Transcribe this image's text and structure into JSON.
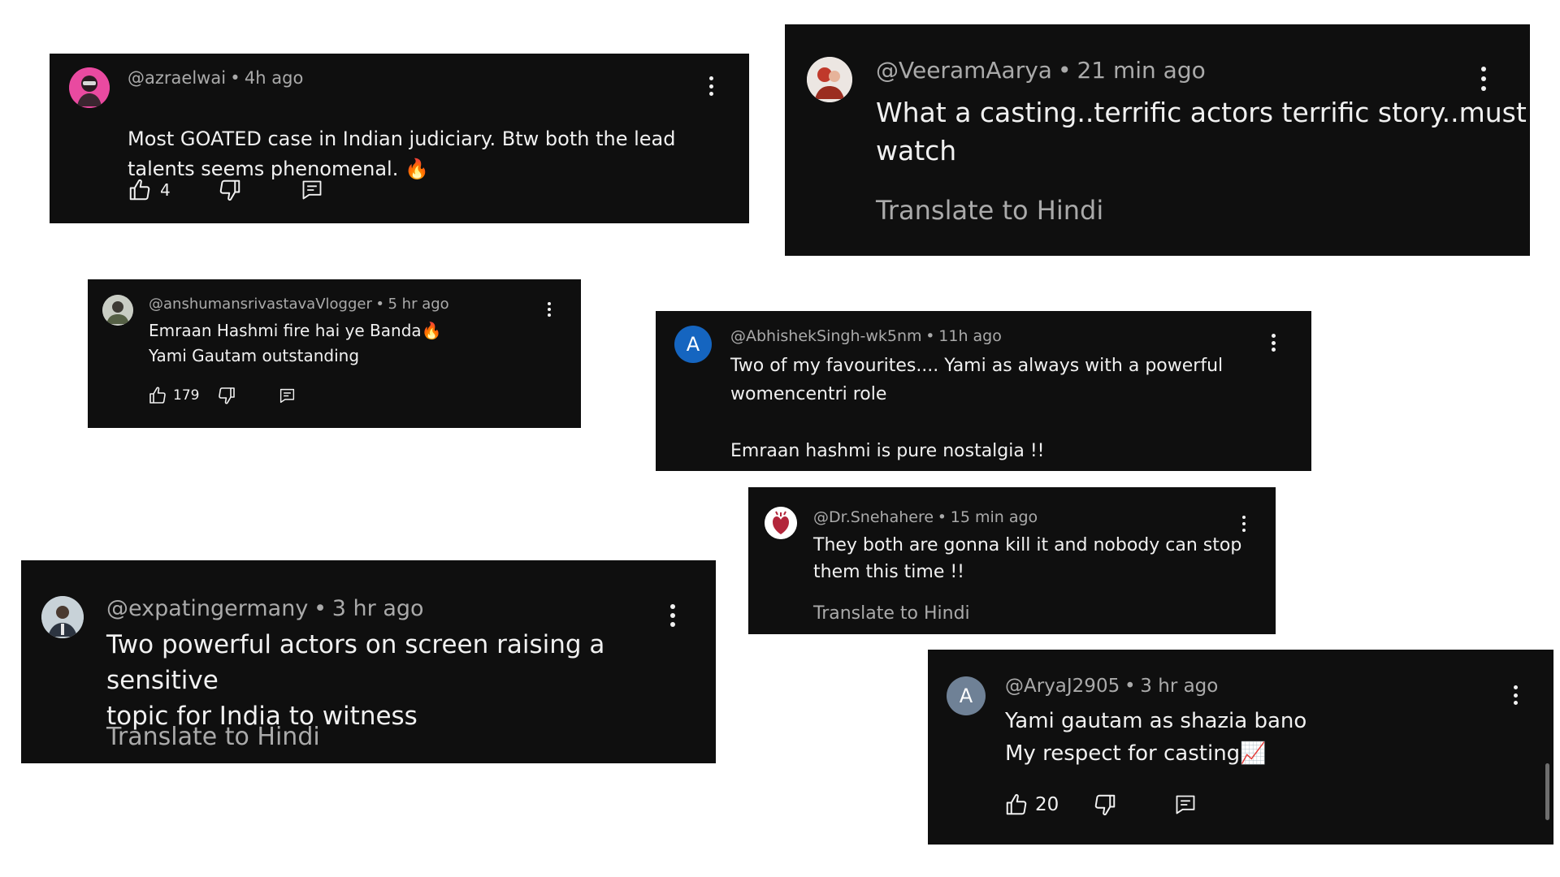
{
  "theme": {
    "card_background": "#0f0f0f",
    "text_primary": "#f1f1f1",
    "text_secondary": "#aaaaaa",
    "avatar_blue": "#1565c0",
    "avatar_gray": "#6f8196"
  },
  "icons": {
    "like": "thumbs-up-icon",
    "dislike": "thumbs-down-icon",
    "reply": "comment-icon",
    "menu": "more-vert-icon",
    "fire": "fire-emoji",
    "chart": "chart-increasing-emoji"
  },
  "comments": [
    {
      "handle": "@azraelwai",
      "time": "4h ago",
      "text": "Most GOATED case in Indian judiciary. Btw both the lead\ntalents seems phenomenal.",
      "emoji": "🔥",
      "likes": "4"
    },
    {
      "handle": "@VeeramAarya",
      "time": "21 min ago",
      "text": "What a casting..terrific actors terrific story..must\nwatch",
      "translate": "Translate to Hindi"
    },
    {
      "handle": "@anshumansrivastavaVlogger",
      "time": "5 hr ago",
      "line1": "Emraan Hashmi fire hai ye Banda",
      "emoji": "🔥",
      "line2": "Yami Gautam outstanding",
      "likes": "179"
    },
    {
      "handle": "@AbhishekSingh-wk5nm",
      "time": "11h ago",
      "avatar_letter": "A",
      "text": "Two of my favourites.... Yami as always with a powerful\nwomencentri role\n\nEmraan hashmi is pure nostalgia !!"
    },
    {
      "handle": "@Dr.Snehahere",
      "time": "15 min ago",
      "text": "They both are gonna kill it and nobody can stop\nthem this time !!",
      "translate": "Translate to Hindi"
    },
    {
      "handle": "@expatingermany",
      "time": "3 hr ago",
      "text": "Two powerful actors on screen raising a sensitive\ntopic for India to witness",
      "translate": "Translate to Hindi"
    },
    {
      "handle": "@AryaJ2905",
      "time": "3 hr ago",
      "avatar_letter": "A",
      "line1": "Yami gautam as shazia bano",
      "line2": "My respect for casting",
      "emoji": "📈",
      "likes": "20"
    }
  ]
}
